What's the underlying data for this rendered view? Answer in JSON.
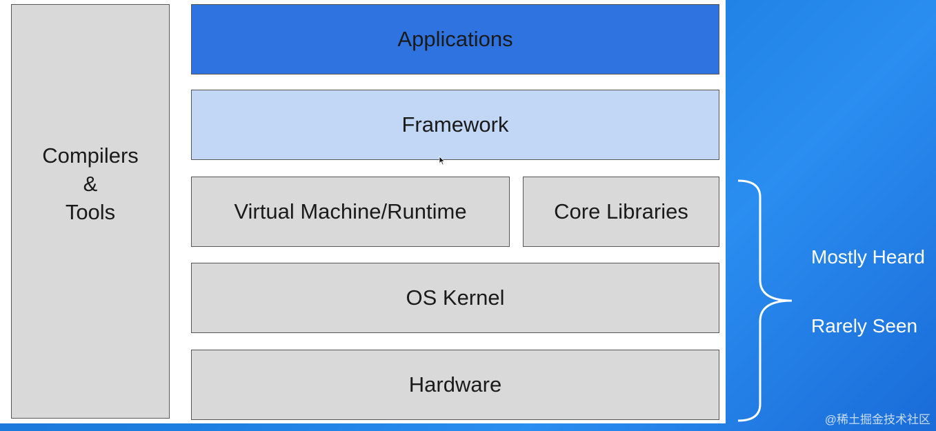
{
  "diagram": {
    "layers": {
      "applications": "Applications",
      "framework": "Framework",
      "virtual_machine": "Virtual Machine/Runtime",
      "core_libraries": "Core Libraries",
      "os_kernel": "OS Kernel",
      "hardware": "Hardware"
    },
    "side_column": {
      "line1": "Compilers",
      "line2": "&",
      "line3": "Tools"
    },
    "annotations": {
      "mostly_heard": "Mostly Heard",
      "rarely_seen": "Rarely Seen"
    },
    "watermark": "@稀土掘金技术社区"
  },
  "colors": {
    "applications_fill": "#2f73e0",
    "framework_fill": "#c2d6f6",
    "gray_fill": "#d9d9d9",
    "background_blue": "#1c7ee0"
  }
}
